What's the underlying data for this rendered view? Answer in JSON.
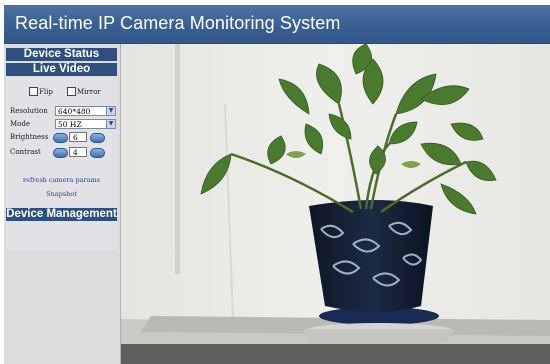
{
  "header": {
    "title": "Real-time IP Camera Monitoring System"
  },
  "sidebar": {
    "device_status": "Device Status",
    "live_video": "Live Video",
    "flip": {
      "label": "Flip",
      "checked": false
    },
    "mirror": {
      "label": "Mirror",
      "checked": false
    },
    "resolution": {
      "label": "Resolution",
      "value": "640*480"
    },
    "mode": {
      "label": "Mode",
      "value": "50 HZ"
    },
    "brightness": {
      "label": "Brightness",
      "value": "6"
    },
    "contrast": {
      "label": "Contrast",
      "value": "4"
    },
    "refresh_link": "refresh camera params",
    "snapshot_link": "Snapshot",
    "device_management": "Device Management"
  },
  "colors": {
    "header_bg": "#3a5f92",
    "section_bg": "#2f4f7f",
    "link": "#1f3f9a",
    "sidebar_bg": "#dcdcdc"
  },
  "video": {
    "feed": "live-camera-feed"
  }
}
